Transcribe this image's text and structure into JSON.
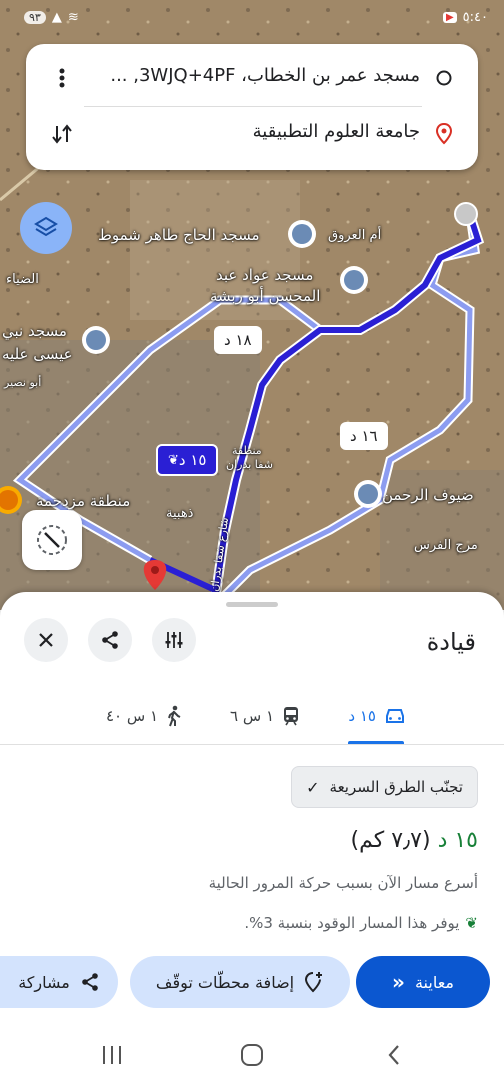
{
  "status_bar": {
    "time": "٥:٤٠",
    "signal_extra": "٩٣",
    "battery": "٩٣"
  },
  "search": {
    "origin": "مسجد عمر بن الخطاب، 3WJQ+4PF, ...",
    "destination": "جامعة العلوم التطبيقية"
  },
  "map": {
    "labels": [
      {
        "name": "mosque-label-taher",
        "text": "مسجد الحاج طاهر شموط"
      },
      {
        "name": "place-label-urouq",
        "text": "أم العروق"
      },
      {
        "name": "mosque-label-awad-1",
        "text": "مسجد عواد عبد"
      },
      {
        "name": "mosque-label-awad-2",
        "text": "المحسن أبو ربشة"
      },
      {
        "name": "place-label-diaa",
        "text": "الضياء"
      },
      {
        "name": "mosque-label-issa-1",
        "text": "مسجد نبي"
      },
      {
        "name": "mosque-label-issa-2",
        "text": "عيسى عليه"
      },
      {
        "name": "place-label-abu-nusair",
        "text": "أبو نصير"
      },
      {
        "name": "place-label-zahma",
        "text": "منطقة مزدحمة"
      },
      {
        "name": "place-label-dhahabiya",
        "text": "ذهبية"
      },
      {
        "name": "place-label-shafa-1",
        "text": "منطقة"
      },
      {
        "name": "place-label-shafa-2",
        "text": "شفا بدران"
      },
      {
        "name": "road-label",
        "text": "شارع شفا بدران"
      },
      {
        "name": "mosque-label-duyouf",
        "text": "ضيوف الرحمن"
      },
      {
        "name": "place-label-marj",
        "text": "مرج الفرس"
      }
    ],
    "route_main_label": "١٥ د",
    "route_alt1_label": "١٨ د",
    "route_alt2_label": "١٦ د"
  },
  "sheet": {
    "title": "قيادة",
    "tabs": [
      {
        "label": "١٥ د",
        "icon": "car-icon"
      },
      {
        "label": "١ س ٦",
        "icon": "train-icon"
      },
      {
        "label": "١ س ٤٠",
        "icon": "walk-icon"
      }
    ],
    "chip_label": "تجنّب الطرق السريعة",
    "duration": "١٥ د",
    "distance": "(٧٫٧ كم)",
    "description": "أسرع مسار الآن بسبب حركة المرور الحالية",
    "fuel_note": "يوفر هذا المسار الوقود بنسبة 3%.",
    "buttons": {
      "preview": "معاينة",
      "add_stops": "إضافة محطّات توقّف",
      "share": "مشاركة"
    }
  },
  "colors": {
    "route_main": "#2a1fd4",
    "route_alt": "#8c9cf0",
    "accent": "#1a73e8",
    "preview_bg": "#0b57d0",
    "chip_bg": "#d3e3fd"
  }
}
